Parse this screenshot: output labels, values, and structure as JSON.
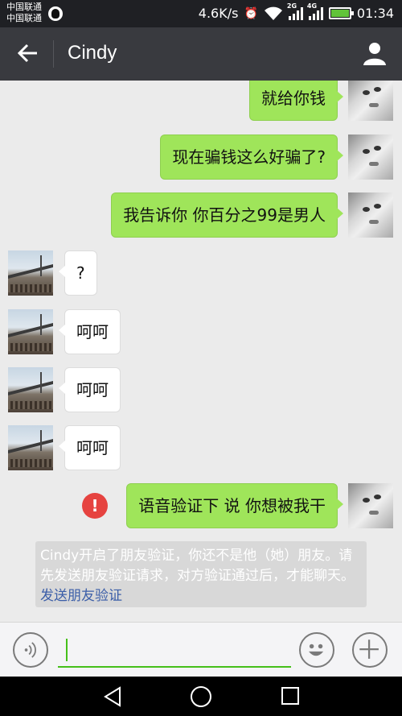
{
  "status_bar": {
    "carrier_line1": "中国联通",
    "carrier_line2": "中国联通",
    "speed": "4.6K/s",
    "network1": "2G",
    "network2": "4G",
    "time": "01:34",
    "icons": [
      "qq-icon",
      "alarm-icon",
      "wifi-icon",
      "signal-icon",
      "battery-icon"
    ]
  },
  "header": {
    "title": "Cindy",
    "back_icon": "arrow-left-icon",
    "profile_icon": "person-icon"
  },
  "messages": [
    {
      "sender": "me",
      "text": "就给你钱"
    },
    {
      "sender": "me",
      "text": "现在骗钱这么好骗了?"
    },
    {
      "sender": "me",
      "text": "我告诉你 你百分之99是男人"
    },
    {
      "sender": "her",
      "text": "?"
    },
    {
      "sender": "her",
      "text": "呵呵"
    },
    {
      "sender": "her",
      "text": "呵呵"
    },
    {
      "sender": "her",
      "text": "呵呵"
    },
    {
      "sender": "me",
      "text": "语音验证下 说 你想被我干",
      "failed": true,
      "error_mark": "!"
    }
  ],
  "system_notice": {
    "text": "Cindy开启了朋友验证，你还不是他（她）朋友。请先发送朋友验证请求，对方验证通过后，才能聊天。",
    "link": "发送朋友验证"
  },
  "input_bar": {
    "value": "",
    "icons": [
      "voice-icon",
      "emoji-icon",
      "plus-icon"
    ]
  },
  "nav_bar": {
    "icons": [
      "back-triangle-icon",
      "home-circle-icon",
      "recent-square-icon"
    ]
  },
  "colors": {
    "header_bg": "#393a3f",
    "status_bg": "#1f2024",
    "chat_bg": "#ebebeb",
    "my_bubble": "#9fe55a",
    "her_bubble": "#ffffff",
    "error_red": "#e64340",
    "accent_green": "#45c01a",
    "link_blue": "#3b5ea8"
  }
}
